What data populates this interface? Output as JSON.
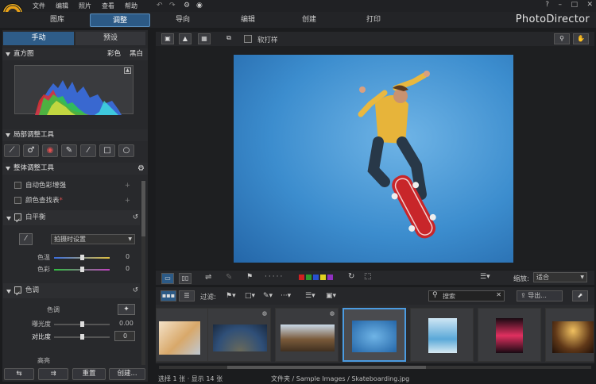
{
  "menu": {
    "items": [
      "文件",
      "编辑",
      "照片",
      "查看",
      "帮助"
    ]
  },
  "modules": {
    "tabs": [
      "图库",
      "调整",
      "导向",
      "编辑",
      "创建",
      "打印"
    ],
    "active": "调整"
  },
  "brand": "PhotoDirector",
  "panel": {
    "subtabs": [
      "手动",
      "预设"
    ],
    "histogram": {
      "title": "直方图",
      "color": "彩色",
      "bw": "黑白"
    },
    "local_tools": {
      "title": "局部调整工具"
    },
    "global_tools": {
      "title": "整体调整工具"
    },
    "auto_color": "自动色彩增强",
    "color_finder": "颜色查找表",
    "white_balance": {
      "title": "白平衡",
      "preset": "拍摄时设置",
      "temp_label": "色温",
      "temp_value": "0",
      "tint_label": "色彩",
      "tint_value": "0"
    },
    "tone": {
      "title": "色调",
      "label": "色调",
      "exposure_label": "曝光度",
      "exposure_value": "0.00",
      "contrast_label": "对比度",
      "contrast_value": "0",
      "next_label": "高亮"
    },
    "buttons": [
      "",
      "",
      "重置",
      "创建..."
    ]
  },
  "view": {
    "soft_proof": "软打样"
  },
  "filter": {
    "label": "过滤:",
    "search_placeholder": "搜索",
    "zoom_label": "缩放:",
    "zoom_value": "适合",
    "export": "导出..."
  },
  "status": {
    "selection": "选择 1 张 · 显示 14 张",
    "path": "文件夹 / Sample Images / Skateboarding.jpg"
  }
}
